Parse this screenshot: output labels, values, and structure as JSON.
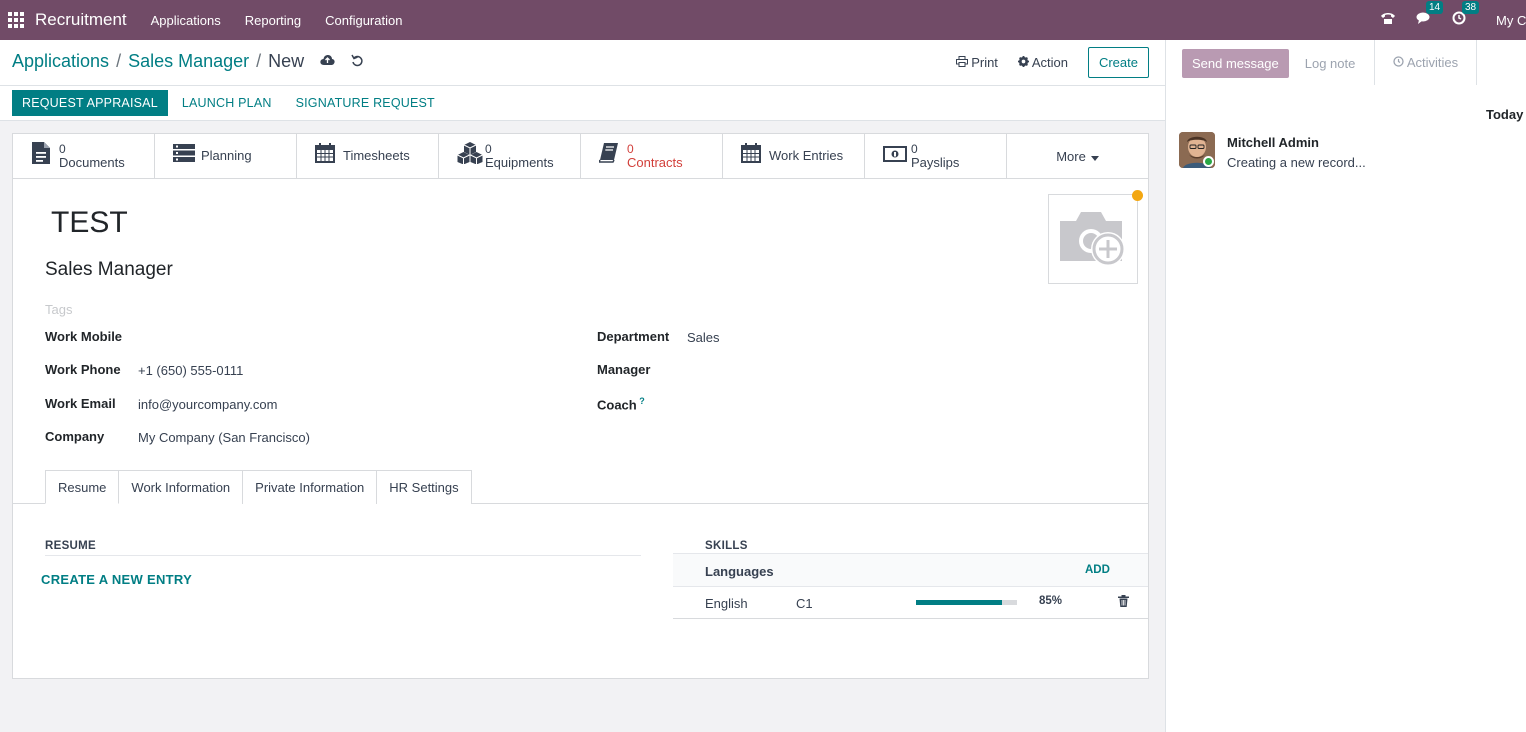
{
  "navbar": {
    "app_name": "Recruitment",
    "menu": [
      "Applications",
      "Reporting",
      "Configuration"
    ],
    "messages_count": "14",
    "activities_count": "38",
    "company": "My C"
  },
  "breadcrumb": {
    "items": [
      "Applications",
      "Sales Manager"
    ],
    "current": "New"
  },
  "control_panel": {
    "print_label": "Print",
    "action_label": "Action",
    "create_label": "Create"
  },
  "status_bar": {
    "buttons": [
      "REQUEST APPRAISAL",
      "LAUNCH PLAN",
      "SIGNATURE REQUEST"
    ]
  },
  "smart_buttons": [
    {
      "value": "0",
      "label": "Documents"
    },
    {
      "label": "Planning"
    },
    {
      "label": "Timesheets"
    },
    {
      "value": "0",
      "label": "Equipments"
    },
    {
      "value": "0",
      "label": "Contracts"
    },
    {
      "label": "Work Entries"
    },
    {
      "value": "0",
      "label": "Payslips"
    },
    {
      "label": "More"
    }
  ],
  "employee": {
    "name": "TEST",
    "job_title": "Sales Manager",
    "tags_placeholder": "Tags"
  },
  "fields": {
    "work_mobile_label": "Work Mobile",
    "work_mobile": "",
    "work_phone_label": "Work Phone",
    "work_phone": "+1 (650) 555-0111",
    "work_email_label": "Work Email",
    "work_email": "info@yourcompany.com",
    "company_label": "Company",
    "company": "My Company (San Francisco)",
    "department_label": "Department",
    "department": "Sales",
    "manager_label": "Manager",
    "manager": "",
    "coach_label": "Coach",
    "coach": ""
  },
  "tabs": [
    "Resume",
    "Work Information",
    "Private Information",
    "HR Settings"
  ],
  "resume": {
    "title": "RESUME",
    "create_entry": "CREATE A NEW ENTRY"
  },
  "skills": {
    "title": "SKILLS",
    "group": "Languages",
    "add_label": "ADD",
    "rows": [
      {
        "skill": "English",
        "level": "C1",
        "progress": 85,
        "progress_label": "85%"
      }
    ]
  },
  "chatter": {
    "send_message": "Send message",
    "log_note": "Log note",
    "activities": "Activities",
    "date_separator": "Today",
    "messages": [
      {
        "author": "Mitchell Admin",
        "body": "Creating a new record..."
      }
    ]
  },
  "colors": {
    "navbar": "#714b67",
    "primary": "#017e84",
    "danger": "#d23f3a"
  }
}
